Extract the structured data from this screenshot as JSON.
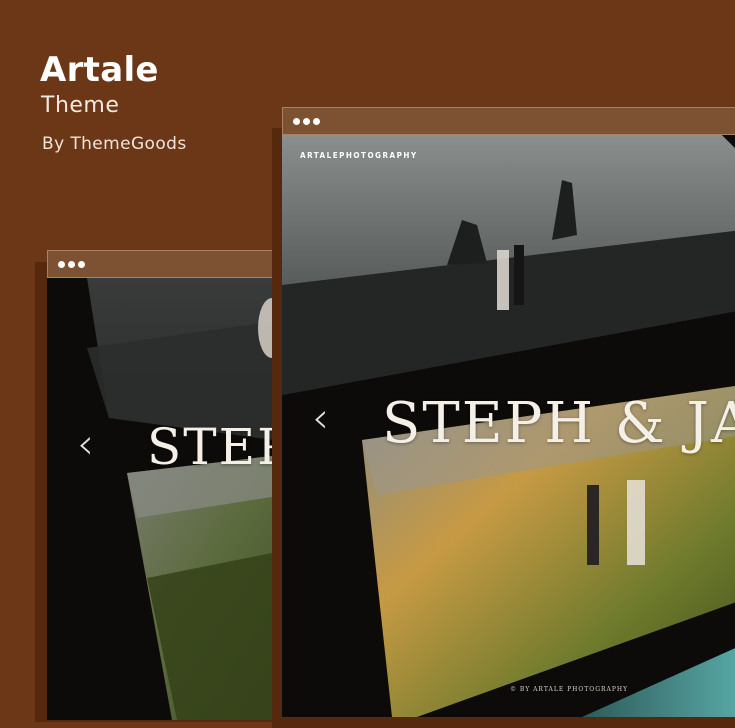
{
  "brand": {
    "title": "Artale",
    "subtitle": "Theme",
    "author": "By ThemeGoods"
  },
  "window_back": {
    "hero_title": "STEPH & JANE",
    "prev_arrow": "‹"
  },
  "window_front": {
    "logo": "ARTALEPHOTOGRAPHY",
    "hero_title": "STEPH & JANE",
    "prev_arrow": "‹",
    "copyright": "© BY ARTALE PHOTOGRAPHY"
  },
  "colors": {
    "background": "#6b3716",
    "titlebar": "#7d5232",
    "dark": "#0f0c0a"
  }
}
